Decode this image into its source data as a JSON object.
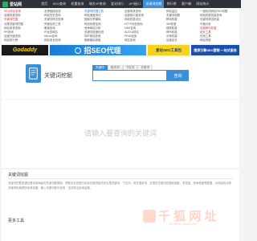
{
  "header": {
    "logo_text": "爱站网",
    "nav": [
      "首页",
      "SEO查询",
      "权重查询",
      "域名/IP查询",
      "爱站排行",
      "API接口",
      "关键词挖掘",
      "排行榜",
      "客户端",
      "网站统计"
    ],
    "active_nav_index": 6
  },
  "links": {
    "col1": [
      {
        "text": "·SEO综合查询",
        "tone": "red"
      },
      {
        "text": "·百度权重查询",
        "tone": "normal"
      },
      {
        "text": "·关键词挖掘",
        "tone": "red"
      },
      {
        "text": "·长尾关键词挖掘",
        "tone": "normal"
      },
      {
        "text": "·网站收录查询",
        "tone": "normal"
      },
      {
        "text": "·PR查询",
        "tone": "normal"
      },
      {
        "text": "·百度外链查询",
        "tone": "normal"
      },
      {
        "text": "·网站排行榜",
        "tone": "normal"
      }
    ],
    "col2": [
      {
        "text": "·友情链接检测",
        "tone": "normal"
      },
      {
        "text": "·网站历史查询",
        "tone": "normal"
      },
      {
        "text": "·关键词排名查询",
        "tone": "normal"
      },
      {
        "text": "·死链检测工具",
        "tone": "normal"
      },
      {
        "text": "·备案查询",
        "tone": "normal"
      },
      {
        "text": "·IP反查域名",
        "tone": "normal"
      },
      {
        "text": "·Whois查询",
        "tone": "normal"
      },
      {
        "text": "·网站安全检测",
        "tone": "normal"
      }
    ],
    "col3": [
      {
        "text": "·关键词挖掘工具",
        "tone": "blue"
      },
      {
        "text": "·网站速度测试",
        "tone": "normal"
      },
      {
        "text": "·搜索引擎模拟",
        "tone": "normal"
      },
      {
        "text": "·网页标签检测",
        "tone": "normal"
      },
      {
        "text": "·竞争网站分析",
        "tone": "normal"
      },
      {
        "text": "·关键词密度检测",
        "tone": "normal"
      },
      {
        "text": "·同IP网站查询",
        "tone": "normal"
      },
      {
        "text": "·蜘蛛模拟抓取",
        "tone": "normal"
      }
    ],
    "col4": [
      {
        "text": "·百度收录查询",
        "tone": "normal"
      },
      {
        "text": "·百度索引量查询",
        "tone": "normal"
      },
      {
        "text": "·网站权重对比",
        "tone": "normal"
      },
      {
        "text": "·HTTP状态查询",
        "tone": "normal"
      },
      {
        "text": "·DNS查询",
        "tone": "normal"
      },
      {
        "text": "·ALEXA排名",
        "tone": "normal"
      },
      {
        "text": "·PING检测",
        "tone": "normal"
      },
      {
        "text": "·域名查询",
        "tone": "normal"
      }
    ],
    "col5": [
      {
        "text": "·网站监控",
        "tone": "normal"
      },
      {
        "text": "·关键词指数",
        "tone": "normal"
      },
      {
        "text": "·移动权重",
        "tone": "normal"
      },
      {
        "text": "·360权重",
        "tone": "normal"
      },
      {
        "text": "·搜狗权重",
        "tone": "normal"
      },
      {
        "text": "·神马权重",
        "tone": "normal"
      },
      {
        "text": "·头条权重",
        "tone": "normal"
      },
      {
        "text": "·百度站长",
        "tone": "normal"
      }
    ],
    "col6": [
      {
        "text": "·一键检测网站SEO问题",
        "tone": "normal"
      },
      {
        "text": "·网站权重批量查询",
        "tone": "normal"
      },
      {
        "text": "·关键词排名批量",
        "tone": "normal"
      },
      {
        "text": "·外链分析",
        "tone": "normal"
      },
      {
        "text": "·百度移动权重",
        "tone": "red"
      },
      {
        "text": "·站长工具",
        "tone": "normal"
      },
      {
        "text": "·在线工具",
        "tone": "normal"
      },
      {
        "text": "·网站导航",
        "tone": "normal"
      }
    ]
  },
  "ads": {
    "ad1": "Godaddy",
    "ad2": "招SEO代理",
    "ad3": "爱站SEO工具包",
    "ad4": "搜索引擎SEO营销 一站式服务"
  },
  "tool": {
    "title": "关键词挖掘",
    "tabs": [
      "关键词",
      "相关词",
      "下拉词",
      "长尾词"
    ],
    "active_tab_index": 0,
    "search_placeholder": "",
    "search_button": "查询"
  },
  "results": {
    "empty_text": "请输入要查询的关键词"
  },
  "description": {
    "title": "关键词挖掘",
    "text": "关键词挖掘是通过爱站网海量的关键词数据库，帮助站长挖掘与目标关键词相关的长尾关键词、下拉词、相关搜索词，并提供关键词的搜索指数、收录量、竞争程度等数据，为网站优化和关键词布局提供参考依据。输入关键词即可查询，支持导出查询结果。",
    "more_title": "更多工具"
  },
  "watermark": {
    "text": "千 狐 网 址",
    "sub": "QIANHU WANGZHI"
  },
  "colors": {
    "accent": "#3a8fd9",
    "nav_bg": "#2f323a",
    "brand_green": "#27ae60"
  }
}
